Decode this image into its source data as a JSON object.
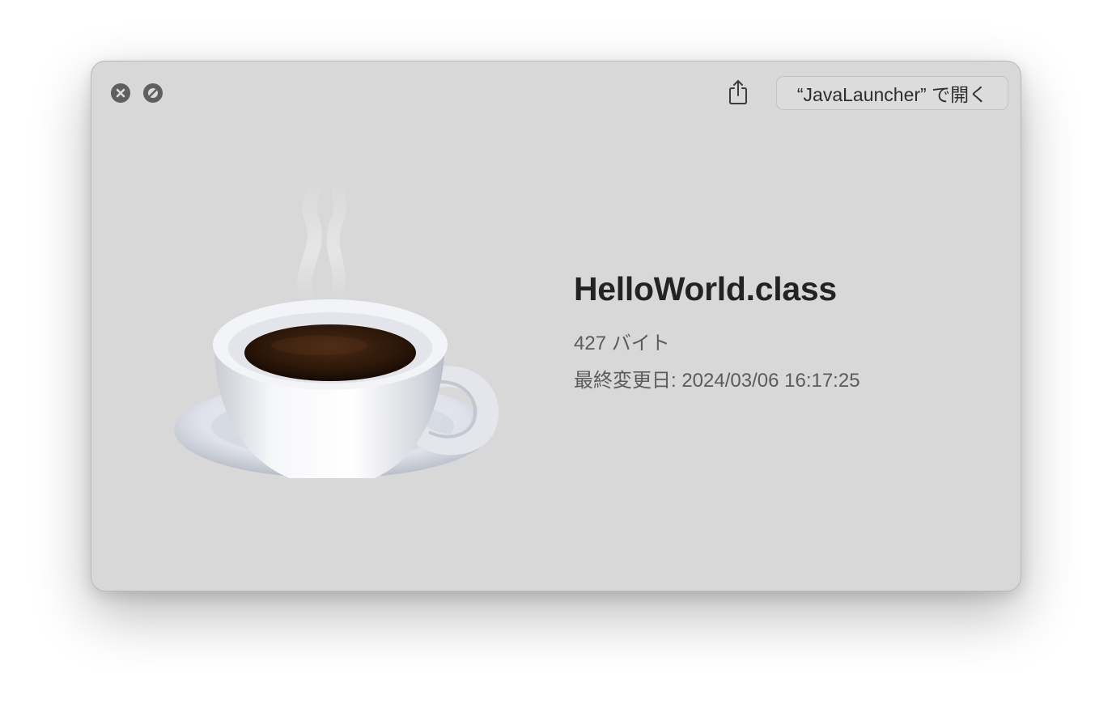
{
  "window": {
    "controls": {
      "close_icon": "close-icon",
      "fullscreen_icon": "fullscreen-slash-icon"
    },
    "toolbar": {
      "share_icon": "share-icon",
      "open_with_label": "“JavaLauncher” で開く"
    }
  },
  "preview": {
    "icon": "coffee-cup-icon",
    "file_name": "HelloWorld.class",
    "file_size": "427 バイト",
    "last_modified": "最終変更日: 2024/03/06 16:17:25"
  },
  "colors": {
    "window_bg": "#d8d8d8",
    "control_button": "#5f5f5f",
    "title_text": "#232323",
    "meta_text": "#5b5b5b"
  }
}
